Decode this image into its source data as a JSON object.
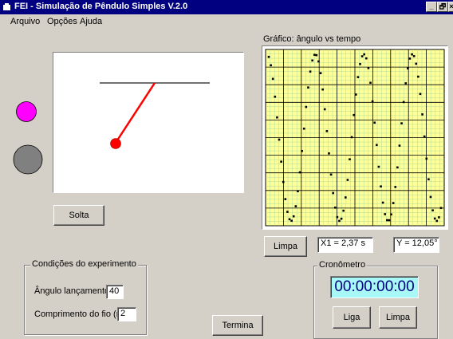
{
  "window": {
    "title": "FEI - Simulação de Pêndulo Simples V.2.0",
    "controls": [
      "_",
      "🗗",
      "×"
    ]
  },
  "menu": [
    "Arquivo",
    "Opções",
    "Ajuda"
  ],
  "simulation": {
    "release_button": "Solta",
    "indicator_colors": [
      "#ff00ff",
      "#808080"
    ]
  },
  "graph": {
    "title": "Gráfico: ângulo vs tempo",
    "background": "#ffff99",
    "clear_button": "Limpa",
    "x_readout": "X1 = 2,37 s",
    "y_readout": "Y = 12,05°"
  },
  "conditions": {
    "legend": "Condições do experimento",
    "angle_label": "Ângulo lançamento:",
    "angle_value": "40",
    "length_label": "Comprimento do fio (m):",
    "length_value": "2"
  },
  "terminate_button": "Termina",
  "stopwatch": {
    "legend": "Cronômetro",
    "display": "00:00:00:00",
    "start_button": "Liga",
    "clear_button": "Limpa"
  }
}
